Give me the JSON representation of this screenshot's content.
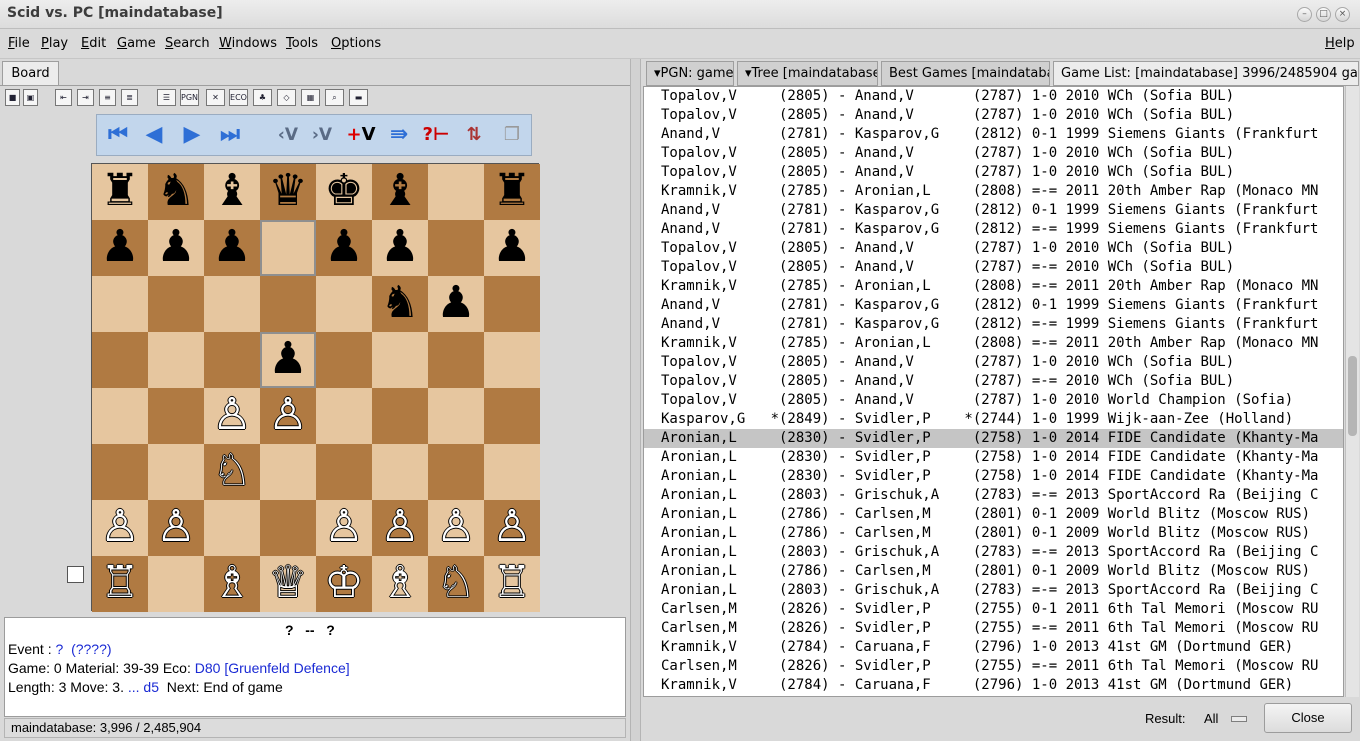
{
  "window": {
    "title": "Scid vs. PC [maindatabase]"
  },
  "menu": [
    "File",
    "Play",
    "Edit",
    "Game",
    "Search",
    "Windows",
    "Tools",
    "Options"
  ],
  "menu_help": "Help",
  "board_tab": "Board",
  "board": {
    "pieces": [
      {
        "sq": "a8",
        "g": "♚",
        "side": "b",
        "name": "rook"
      },
      {
        "sq": "b8",
        "g": "♞",
        "side": "b",
        "name": "knight"
      },
      {
        "sq": "c8",
        "g": "♝",
        "side": "b",
        "name": "bishop"
      },
      {
        "sq": "d8",
        "g": "♛",
        "side": "b",
        "name": "queen"
      },
      {
        "sq": "e8",
        "g": "♚",
        "side": "b",
        "name": "king"
      },
      {
        "sq": "f8",
        "g": "♝",
        "side": "b",
        "name": "bishop"
      },
      {
        "sq": "h8",
        "g": "♜",
        "side": "b",
        "name": "rook"
      },
      {
        "sq": "a7",
        "g": "♟",
        "side": "b",
        "name": "pawn"
      },
      {
        "sq": "b7",
        "g": "♟",
        "side": "b",
        "name": "pawn"
      },
      {
        "sq": "c7",
        "g": "♟",
        "side": "b",
        "name": "pawn"
      },
      {
        "sq": "e7",
        "g": "♟",
        "side": "b",
        "name": "pawn"
      },
      {
        "sq": "f7",
        "g": "♟",
        "side": "b",
        "name": "pawn"
      },
      {
        "sq": "h7",
        "g": "♟",
        "side": "b",
        "name": "pawn"
      },
      {
        "sq": "f6",
        "g": "♞",
        "side": "b",
        "name": "knight"
      },
      {
        "sq": "g6",
        "g": "♟",
        "side": "b",
        "name": "pawn"
      },
      {
        "sq": "d5",
        "g": "♟",
        "side": "b",
        "name": "pawn"
      },
      {
        "sq": "c4",
        "g": "♙",
        "side": "w",
        "name": "pawn"
      },
      {
        "sq": "d4",
        "g": "♙",
        "side": "w",
        "name": "pawn"
      },
      {
        "sq": "c3",
        "g": "♘",
        "side": "w",
        "name": "knight"
      },
      {
        "sq": "a2",
        "g": "♙",
        "side": "w",
        "name": "pawn"
      },
      {
        "sq": "b2",
        "g": "♙",
        "side": "w",
        "name": "pawn"
      },
      {
        "sq": "e2",
        "g": "♙",
        "side": "w",
        "name": "pawn"
      },
      {
        "sq": "f2",
        "g": "♙",
        "side": "w",
        "name": "pawn"
      },
      {
        "sq": "g2",
        "g": "♙",
        "side": "w",
        "name": "pawn"
      },
      {
        "sq": "h2",
        "g": "♙",
        "side": "w",
        "name": "pawn"
      },
      {
        "sq": "a1",
        "g": "♖",
        "side": "w",
        "name": "rook"
      },
      {
        "sq": "c1",
        "g": "♗",
        "side": "w",
        "name": "bishop"
      },
      {
        "sq": "d1",
        "g": "♕",
        "side": "w",
        "name": "queen"
      },
      {
        "sq": "e1",
        "g": "♔",
        "side": "w",
        "name": "king"
      },
      {
        "sq": "f1",
        "g": "♗",
        "side": "w",
        "name": "bishop"
      },
      {
        "sq": "g1",
        "g": "♘",
        "side": "w",
        "name": "knight"
      },
      {
        "sq": "h1",
        "g": "♖",
        "side": "w",
        "name": "rook"
      }
    ],
    "highlight": [
      "d7",
      "d5"
    ]
  },
  "toolbar_icons": [
    "save-icon",
    "bookmark-icon",
    "indent-icon",
    "indent2-icon",
    "outdent-icon",
    "outdent2-icon",
    "list-icon",
    "pgn-icon",
    "tools-icon",
    "eco-icon",
    "tree-icon",
    "analysis-icon",
    "crosstable-icon",
    "search-icon",
    "train-icon"
  ],
  "nav_icons": [
    "first-move-icon",
    "back-icon",
    "forward-icon",
    "last-move-icon",
    "previous-variation-icon",
    "next-variation-icon",
    "add-variation-icon",
    "autoplay-icon",
    "hint-icon",
    "flip-board-icon",
    "copy-icon"
  ],
  "info": {
    "players": "?",
    "sep": "--",
    "players2": "?",
    "event_label": "Event :",
    "event_value": "?",
    "event_date": "(????)",
    "game_label": "Game: 0   Material: 39-39   Eco:",
    "eco": "D80 [Gruenfeld Defence]",
    "length_label": "Length: 3   Move:  3.",
    "move": "... d5",
    "next_label": "Next:  End of game"
  },
  "status": "maindatabase:  3,996 / 2,485,904",
  "right_tabs": [
    "▾PGN: game",
    "▾Tree [maindatabase",
    "Best Games [maindatabase",
    "Game List: [maindatabase] 3996/2485904 gar"
  ],
  "game_rows": [
    "Topalov,V     (2805) - Anand,V       (2787) 1-0 2010 WCh (Sofia BUL)",
    "Topalov,V     (2805) - Anand,V       (2787) 1-0 2010 WCh (Sofia BUL)",
    "Anand,V       (2781) - Kasparov,G    (2812) 0-1 1999 Siemens Giants (Frankfurt",
    "Topalov,V     (2805) - Anand,V       (2787) 1-0 2010 WCh (Sofia BUL)",
    "Topalov,V     (2805) - Anand,V       (2787) 1-0 2010 WCh (Sofia BUL)",
    "Kramnik,V     (2785) - Aronian,L     (2808) =-= 2011 20th Amber Rap (Monaco MN",
    "Anand,V       (2781) - Kasparov,G    (2812) 0-1 1999 Siemens Giants (Frankfurt",
    "Anand,V       (2781) - Kasparov,G    (2812) =-= 1999 Siemens Giants (Frankfurt",
    "Topalov,V     (2805) - Anand,V       (2787) 1-0 2010 WCh (Sofia BUL)",
    "Topalov,V     (2805) - Anand,V       (2787) =-= 2010 WCh (Sofia BUL)",
    "Kramnik,V     (2785) - Aronian,L     (2808) =-= 2011 20th Amber Rap (Monaco MN",
    "Anand,V       (2781) - Kasparov,G    (2812) 0-1 1999 Siemens Giants (Frankfurt",
    "Anand,V       (2781) - Kasparov,G    (2812) =-= 1999 Siemens Giants (Frankfurt",
    "Kramnik,V     (2785) - Aronian,L     (2808) =-= 2011 20th Amber Rap (Monaco MN",
    "Topalov,V     (2805) - Anand,V       (2787) 1-0 2010 WCh (Sofia BUL)",
    "Topalov,V     (2805) - Anand,V       (2787) =-= 2010 WCh (Sofia BUL)",
    "Topalov,V     (2805) - Anand,V       (2787) 1-0 2010 World Champion (Sofia)",
    "Kasparov,G   *(2849) - Svidler,P    *(2744) 1-0 1999 Wijk-aan-Zee (Holland)",
    "Aronian,L     (2830) - Svidler,P     (2758) 1-0 2014 FIDE Candidate (Khanty-Ma",
    "Aronian,L     (2830) - Svidler,P     (2758) 1-0 2014 FIDE Candidate (Khanty-Ma",
    "Aronian,L     (2830) - Svidler,P     (2758) 1-0 2014 FIDE Candidate (Khanty-Ma",
    "Aronian,L     (2803) - Grischuk,A    (2783) =-= 2013 SportAccord Ra (Beijing C",
    "Aronian,L     (2786) - Carlsen,M     (2801) 0-1 2009 World Blitz (Moscow RUS)",
    "Aronian,L     (2786) - Carlsen,M     (2801) 0-1 2009 World Blitz (Moscow RUS)",
    "Aronian,L     (2803) - Grischuk,A    (2783) =-= 2013 SportAccord Ra (Beijing C",
    "Aronian,L     (2786) - Carlsen,M     (2801) 0-1 2009 World Blitz (Moscow RUS)",
    "Aronian,L     (2803) - Grischuk,A    (2783) =-= 2013 SportAccord Ra (Beijing C",
    "Carlsen,M     (2826) - Svidler,P     (2755) 0-1 2011 6th Tal Memori (Moscow RU",
    "Carlsen,M     (2826) - Svidler,P     (2755) =-= 2011 6th Tal Memori (Moscow RU",
    "Kramnik,V     (2784) - Caruana,F     (2796) 1-0 2013 41st GM (Dortmund GER)",
    "Carlsen,M     (2826) - Svidler,P     (2755) =-= 2011 6th Tal Memori (Moscow RU",
    "Kramnik,V     (2784) - Caruana,F     (2796) 1-0 2013 41st GM (Dortmund GER)"
  ],
  "selected_row": 18,
  "result_label": "Result:",
  "result_value": "All",
  "close_label": "Close"
}
